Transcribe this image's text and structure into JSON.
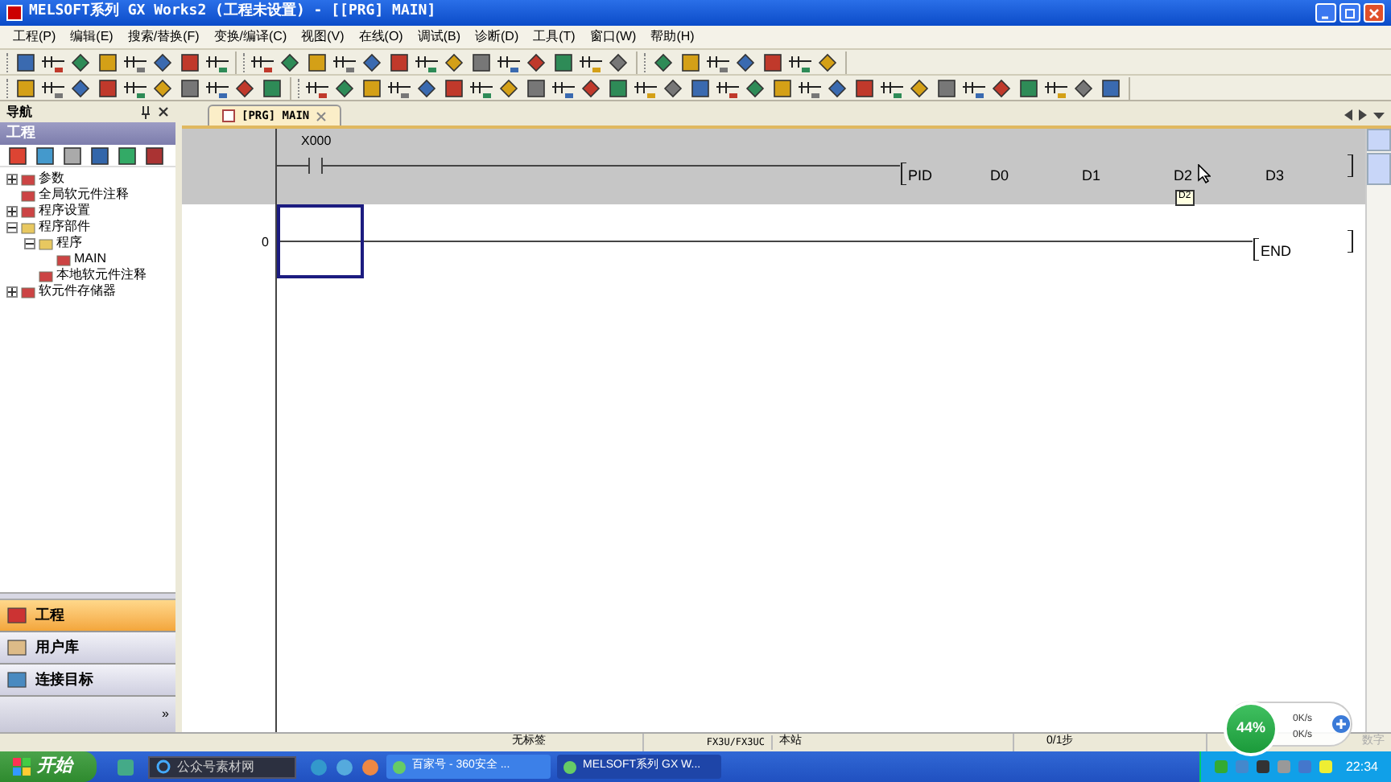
{
  "window": {
    "title": "MELSOFT系列 GX Works2 (工程未设置) - [[PRG] MAIN]"
  },
  "menu": [
    "工程(P)",
    "编辑(E)",
    "搜索/替换(F)",
    "变换/编译(C)",
    "视图(V)",
    "在线(O)",
    "调试(B)",
    "诊断(D)",
    "工具(T)",
    "窗口(W)",
    "帮助(H)"
  ],
  "navigation": {
    "title": "导航",
    "header": "工程",
    "tree": [
      {
        "label": "参数",
        "expanded": false
      },
      {
        "label": "全局软元件注释"
      },
      {
        "label": "程序设置",
        "expanded": false
      },
      {
        "label": "程序部件",
        "expanded": true,
        "children": [
          {
            "label": "程序",
            "expanded": true,
            "children": [
              {
                "label": "MAIN"
              }
            ]
          },
          {
            "label": "本地软元件注释"
          }
        ]
      },
      {
        "label": "软元件存储器",
        "expanded": false
      }
    ],
    "sections": [
      {
        "label": "工程",
        "selected": true
      },
      {
        "label": "用户库",
        "selected": false
      },
      {
        "label": "连接目标",
        "selected": false
      }
    ],
    "more": "»"
  },
  "editor": {
    "tab": {
      "label": "[PRG] MAIN",
      "selected": true
    },
    "rungs": [
      {
        "contact": "X000",
        "instruction": [
          "PID",
          "D0",
          "D1",
          "D2",
          "D3"
        ],
        "highlighted": true
      },
      {
        "step": "0",
        "instruction": [
          "END"
        ],
        "highlighted": false
      }
    ],
    "tooltip": "D2"
  },
  "status_bar": [
    "无标签",
    "FX3U/FX3UC",
    "本站",
    "0/1步",
    "数字"
  ],
  "network_widget": {
    "percent": "44%",
    "upload": "0K/s",
    "download": "0K/s"
  },
  "taskbar": {
    "start": "开始",
    "search": "公众号素材网",
    "tasks": [
      {
        "label": "百家号 - 360安全 ...",
        "selected": false
      },
      {
        "label": "MELSOFT系列 GX W...",
        "selected": true
      }
    ],
    "clock": "22:34"
  }
}
